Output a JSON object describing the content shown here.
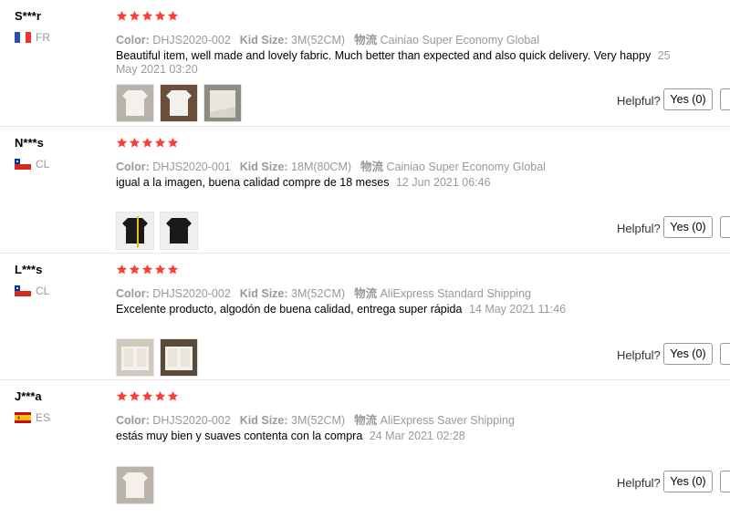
{
  "helpful_label": "Helpful?",
  "star_color": "#f44336",
  "reviews": [
    {
      "user": "S***r",
      "country": "FR",
      "flag": "france",
      "rating": 5,
      "color_label": "Color:",
      "color_value": "DHJS2020-002",
      "size_label": "Kid Size:",
      "size_value": "3M(52CM)",
      "ship_label": "物流",
      "ship_value": "Cainiao Super Economy Global",
      "text": "Beautiful item, well made and lovely fabric. Much better than expected and also quick delivery. Very happy",
      "date": "25 May 2021 03:20",
      "photos": [
        "white-onesie-photo",
        "white-onesie-photo",
        "white-fabric-photo"
      ],
      "yes_label": "Yes (0)"
    },
    {
      "user": "N***s",
      "country": "CL",
      "flag": "chile",
      "rating": 5,
      "color_label": "Color:",
      "color_value": "DHJS2020-001",
      "size_label": "Kid Size:",
      "size_value": "18M(80CM)",
      "ship_label": "物流",
      "ship_value": "Cainiao Super Economy Global",
      "text": "igual a la imagen, buena calidad compre de 18 meses",
      "date": "12 Jun 2021 06:46",
      "photos": [
        "black-onesie-photo",
        "black-onesie-photo"
      ],
      "yes_label": "Yes (0)"
    },
    {
      "user": "L***s",
      "country": "CL",
      "flag": "chile",
      "rating": 5,
      "color_label": "Color:",
      "color_value": "DHJS2020-002",
      "size_label": "Kid Size:",
      "size_value": "3M(52CM)",
      "ship_label": "物流",
      "ship_value": "AliExpress Standard Shipping",
      "text": "Excelente producto, algodón de buena calidad, entrega super rápida",
      "date": "14 May 2021 11:46",
      "photos": [
        "white-onesies-photo",
        "white-onesies-photo"
      ],
      "yes_label": "Yes (0)"
    },
    {
      "user": "J***a",
      "country": "ES",
      "flag": "spain",
      "rating": 5,
      "color_label": "Color:",
      "color_value": "DHJS2020-002",
      "size_label": "Kid Size:",
      "size_value": "3M(52CM)",
      "ship_label": "物流",
      "ship_value": "AliExpress Saver Shipping",
      "text": "estás muy bien y suaves contenta con la compra",
      "date": "24 Mar 2021 02:28",
      "photos": [
        "white-onesie-photo"
      ],
      "yes_label": "Yes (0)"
    }
  ]
}
